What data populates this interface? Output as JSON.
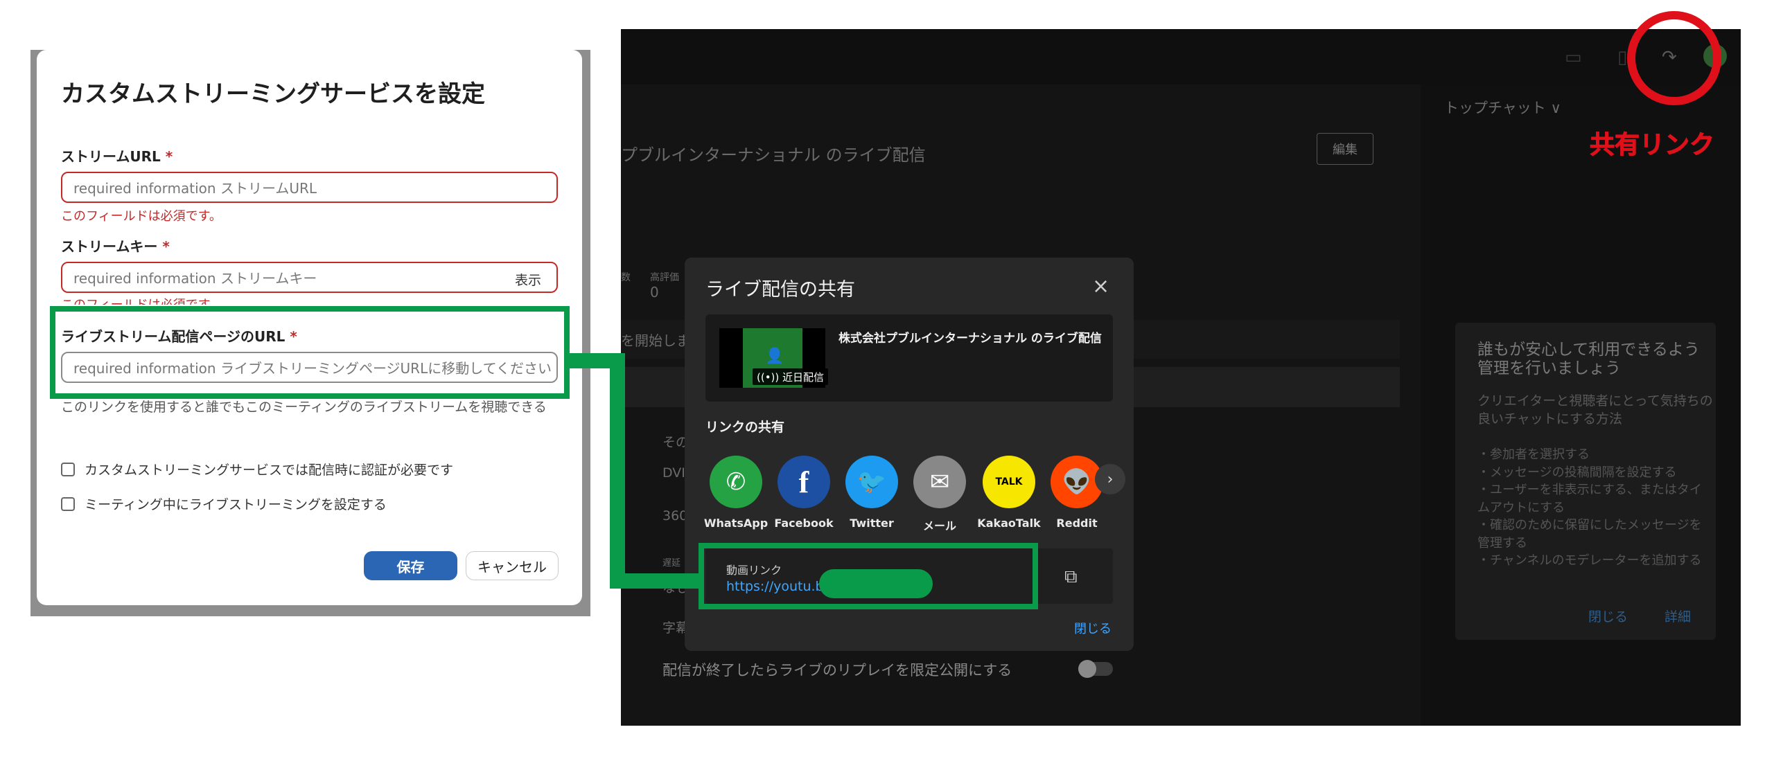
{
  "left_dialog": {
    "title": "カスタムストリーミングサービスを設定",
    "stream_url_label": "ストリームURL",
    "stream_url_placeholder": "required information ストリームURL",
    "stream_url_error": "このフィールドは必須です。",
    "stream_key_label": "ストリームキー",
    "stream_key_placeholder": "required information ストリームキー",
    "stream_key_show": "表示",
    "stream_key_error": "このフィールドは必須です。",
    "page_url_label": "ライブストリーム配信ページのURL",
    "page_url_placeholder": "required information ライブストリーミングページURLに移動してください",
    "required_mark": "*",
    "help_text": "このリンクを使用すると誰でもこのミーティングのライブストリームを視聴できる",
    "checkbox_auth": "カスタムストリーミングサービスでは配信時に認証が必要です",
    "checkbox_setup": "ミーティング中にライブストリーミングを設定する",
    "save_label": "保存",
    "cancel_label": "キャンセル"
  },
  "studio": {
    "stream_title": "プブルインターナショナル のライブ配信",
    "edit_label": "編集",
    "top_chat_label": "トップチャット ∨",
    "stat_small_1": "数",
    "stat_small_2": "高評価",
    "stat_value": "0",
    "start_text": "を開始しま",
    "side_row_1": "その",
    "side_row_2": "DVI",
    "side_row_3": "360",
    "side_row_4": "遅延",
    "side_row_5": "なし",
    "side_row_6": "字幕",
    "replay_setting": "配信が終了したらライブのリプレイを限定公開にする",
    "help_card": {
      "title": "誰もが安心して利用できるよう管理を行いましょう",
      "subtitle": "クリエイターと視聴者にとって気持ちの良いチャットにする方法",
      "items": [
        "・参加者を選択する",
        "・メッセージの投稿間隔を設定する",
        "・ユーザーを非表示にする、またはタイムアウトにする",
        "・確認のために保留にしたメッセージを管理する",
        "・チャンネルのモデレーターを追加する"
      ],
      "close_label": "閉じる",
      "details_label": "詳細"
    }
  },
  "share_modal": {
    "title": "ライブ配信の共有",
    "close_icon": "×",
    "video_title": "株式会社プブルインターナショナル のライブ配信",
    "badge": "((•)) 近日配信",
    "section_label": "リンクの共有",
    "services": [
      {
        "label": "WhatsApp",
        "icon": "whatsapp-icon",
        "glyph": "✆",
        "color": "#25a244"
      },
      {
        "label": "Facebook",
        "icon": "facebook-icon",
        "glyph": "f",
        "color": "#1d4fa3"
      },
      {
        "label": "Twitter",
        "icon": "twitter-icon",
        "glyph": "🐦",
        "color": "#1d9bf0"
      },
      {
        "label": "メール",
        "icon": "mail-icon",
        "glyph": "✉",
        "color": "#888888"
      },
      {
        "label": "KakaoTalk",
        "icon": "kakaotalk-icon",
        "glyph": "TALK",
        "color": "#f7e600"
      },
      {
        "label": "Reddit",
        "icon": "reddit-icon",
        "glyph": "👽",
        "color": "#ff4500"
      }
    ],
    "link_label": "動画リンク",
    "link_url": "https://youtu.be",
    "close_link": "閉じる"
  },
  "annotation": {
    "label": "共有リンク",
    "circle_color": "#e0101a",
    "box_color": "#0a9b4a"
  }
}
